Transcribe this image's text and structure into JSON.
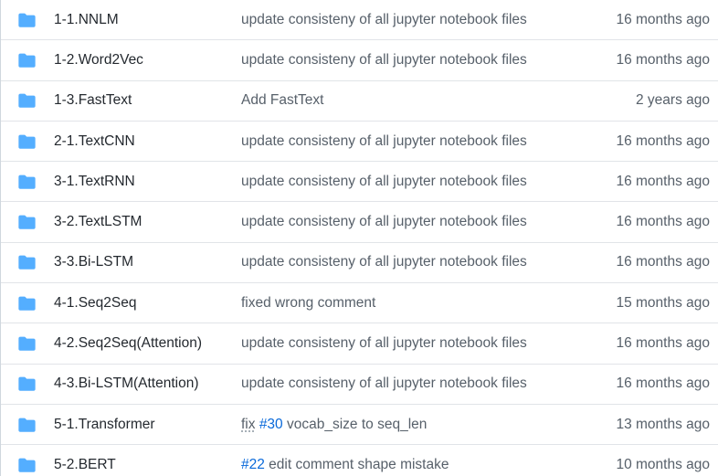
{
  "colors": {
    "folder_icon": "#54aeff",
    "name_text": "#24292f",
    "muted_text": "#57606a",
    "issue_link": "#0969da",
    "row_border": "#e1e4e8"
  },
  "icons": {
    "folder": "folder-icon"
  },
  "rows": [
    {
      "name": "1-1.NNLM",
      "message": "update consisteny of all jupyter notebook files",
      "age": "16 months ago"
    },
    {
      "name": "1-2.Word2Vec",
      "message": "update consisteny of all jupyter notebook files",
      "age": "16 months ago"
    },
    {
      "name": "1-3.FastText",
      "message": "Add FastText",
      "age": "2 years ago"
    },
    {
      "name": "2-1.TextCNN",
      "message": "update consisteny of all jupyter notebook files",
      "age": "16 months ago"
    },
    {
      "name": "3-1.TextRNN",
      "message": "update consisteny of all jupyter notebook files",
      "age": "16 months ago"
    },
    {
      "name": "3-2.TextLSTM",
      "message": "update consisteny of all jupyter notebook files",
      "age": "16 months ago"
    },
    {
      "name": "3-3.Bi-LSTM",
      "message": "update consisteny of all jupyter notebook files",
      "age": "16 months ago"
    },
    {
      "name": "4-1.Seq2Seq",
      "message": "fixed wrong comment",
      "age": "15 months ago"
    },
    {
      "name": "4-2.Seq2Seq(Attention)",
      "message": "update consisteny of all jupyter notebook files",
      "age": "16 months ago"
    },
    {
      "name": "4-3.Bi-LSTM(Attention)",
      "message": "update consisteny of all jupyter notebook files",
      "age": "16 months ago"
    },
    {
      "name": "5-1.Transformer",
      "message_parts": [
        "fix",
        " ",
        "#30",
        " vocab_size to seq_len"
      ],
      "age": "13 months ago"
    },
    {
      "name": "5-2.BERT",
      "message_parts": [
        "#22",
        " edit comment shape mistake"
      ],
      "age": "10 months ago"
    }
  ]
}
